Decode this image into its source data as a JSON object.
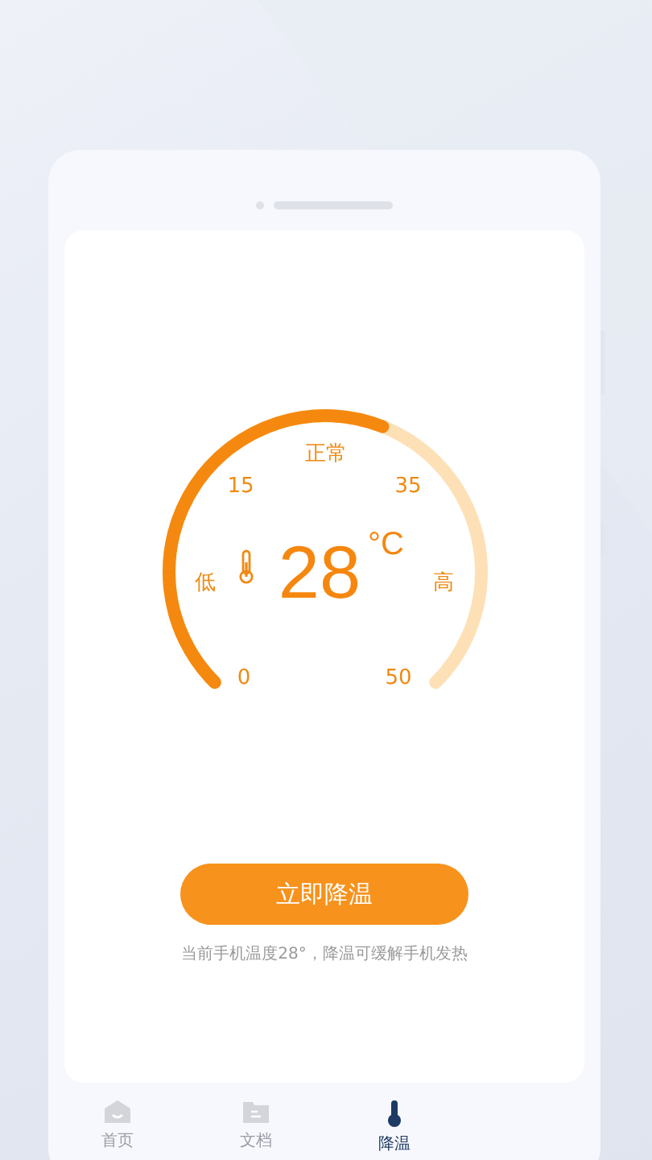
{
  "gauge": {
    "status_label": "正常",
    "low_label": "低",
    "high_label": "高",
    "ticks": [
      "15",
      "35",
      "0",
      "50"
    ],
    "temperature": "28",
    "unit": "°C"
  },
  "cool_button": "立即降温",
  "caption": "当前手机温度28°，降温可缓解手机发热",
  "bottom_nav": [
    {
      "label": "首页",
      "selected": false
    },
    {
      "label": "文档",
      "selected": false
    },
    {
      "label": "降温",
      "selected": true
    }
  ]
}
